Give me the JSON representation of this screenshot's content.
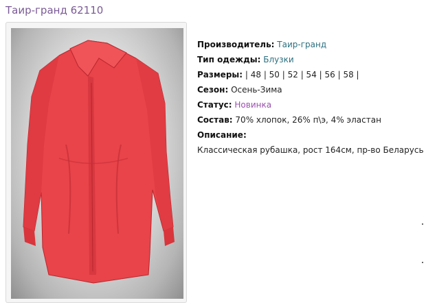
{
  "product": {
    "title": "Таир-гранд 62110"
  },
  "details": {
    "manufacturer": {
      "label": "Производитель:",
      "value": "Таир-гранд"
    },
    "clothing_type": {
      "label": "Тип одежды:",
      "value": "Блузки"
    },
    "sizes": {
      "label": "Размеры:",
      "value": " | 48 | 50 | 52 | 54 | 56 | 58 |"
    },
    "season": {
      "label": "Сезон:",
      "value": " Осень-Зима"
    },
    "status": {
      "label": "Статус:",
      "value": "Новинка"
    },
    "composition": {
      "label": "Состав:",
      "value": " 70% хлопок, 26% п\\э, 4% эластан"
    },
    "description": {
      "label": "Описание:",
      "value": "Классическая рубашка, рост 164см, пр-во Беларусь"
    }
  },
  "colors": {
    "title": "#7a5a95",
    "link_teal": "#2b6f7f",
    "link_violet": "#9a4fb0",
    "shirt": "#e8444a"
  }
}
